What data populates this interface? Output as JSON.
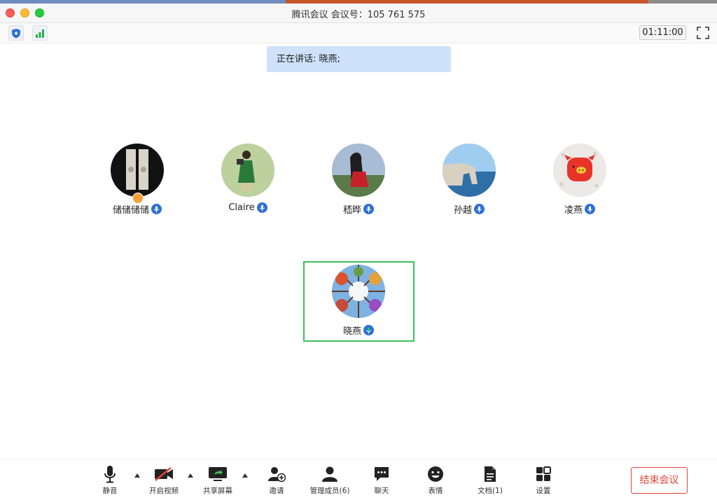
{
  "window": {
    "title": "腾讯会议 会议号：105 761 575"
  },
  "topbar": {
    "timer": "01:11:00"
  },
  "speaking": {
    "text": "正在讲话: 晓燕;"
  },
  "participants": [
    {
      "name": "储储储储",
      "is_host": true
    },
    {
      "name": "Claire"
    },
    {
      "name": "嵇晔"
    },
    {
      "name": "孙越"
    },
    {
      "name": "凌燕"
    },
    {
      "name": "晓燕",
      "active": true
    }
  ],
  "toolbar": {
    "mute": "静音",
    "video": "开启视频",
    "share": "共享屏幕",
    "invite": "邀请",
    "members": "管理成员(6)",
    "chat": "聊天",
    "emoji": "表情",
    "docs": "文档(1)",
    "settings": "设置",
    "end": "结束会议"
  },
  "colors": {
    "accent_blue": "#2d6fd8",
    "speaking_bg": "#cfe2fb",
    "active_border": "#3cbf5b",
    "end_red": "#e5443c"
  }
}
